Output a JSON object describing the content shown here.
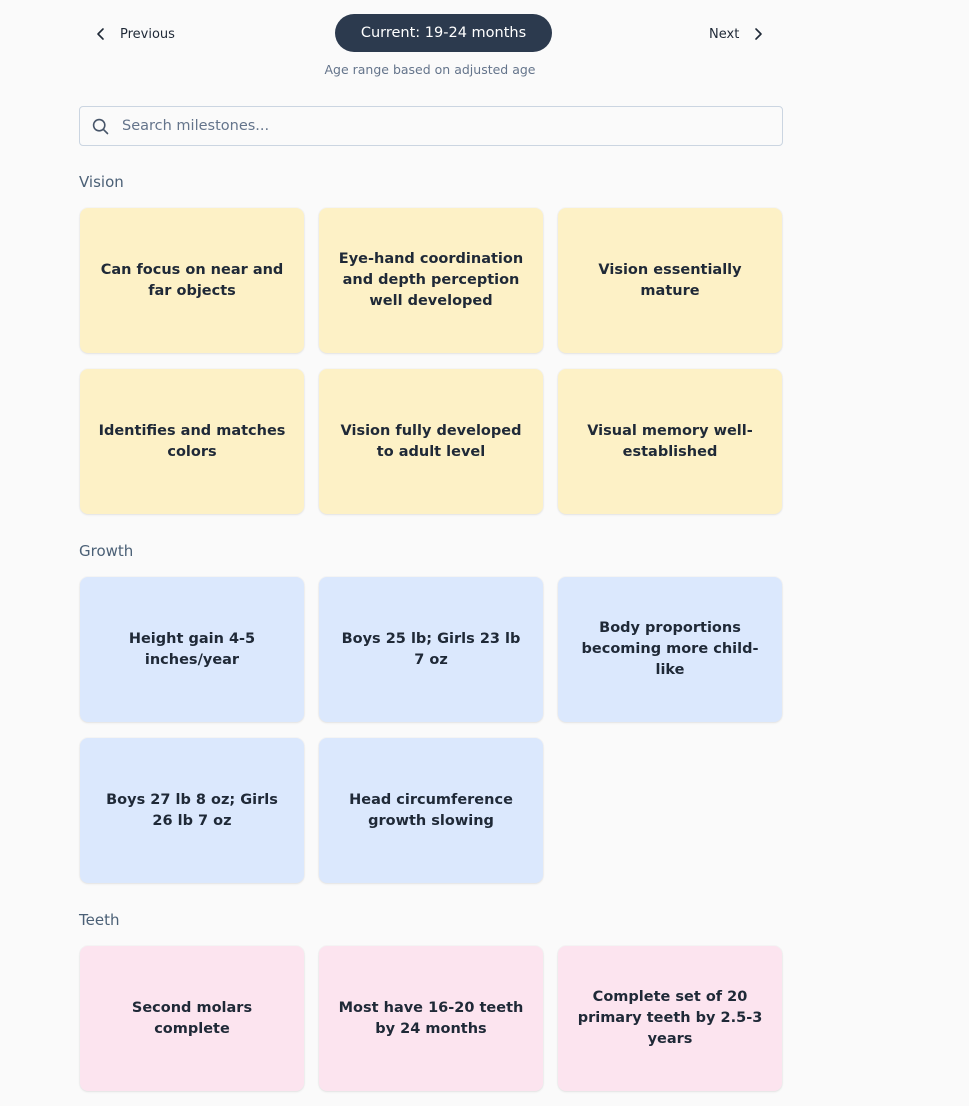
{
  "nav": {
    "previous_label": "Previous",
    "next_label": "Next",
    "current_label": "Current: 19-24 months",
    "age_note": "Age range based on adjusted age"
  },
  "search": {
    "placeholder": "Search milestones..."
  },
  "sections": {
    "vision": {
      "title": "Vision",
      "items": [
        "Can focus on near and far objects",
        "Eye-hand coordination and depth perception well developed",
        "Vision essentially mature",
        "Identifies and matches colors",
        "Vision fully developed to adult level",
        "Visual memory well-established"
      ]
    },
    "growth": {
      "title": "Growth",
      "items": [
        "Height gain 4-5 inches/year",
        "Boys 25 lb; Girls 23 lb 7 oz",
        "Body proportions becoming more child-like",
        "Boys 27 lb 8 oz; Girls 26 lb 7 oz",
        "Head circumference growth slowing"
      ]
    },
    "teeth": {
      "title": "Teeth",
      "items": [
        "Second molars complete",
        "Most have 16-20 teeth by 24 months",
        "Complete set of 20 primary teeth by 2.5-3 years"
      ]
    }
  },
  "colors": {
    "pill": "#2c3a4e",
    "vision_card": "#fdf1c6",
    "growth_card": "#dbe8fd",
    "teeth_card": "#fce4ef",
    "section_title": "#4b6076"
  },
  "icons": [
    "chevron-left-icon",
    "chevron-right-icon",
    "search-icon"
  ]
}
